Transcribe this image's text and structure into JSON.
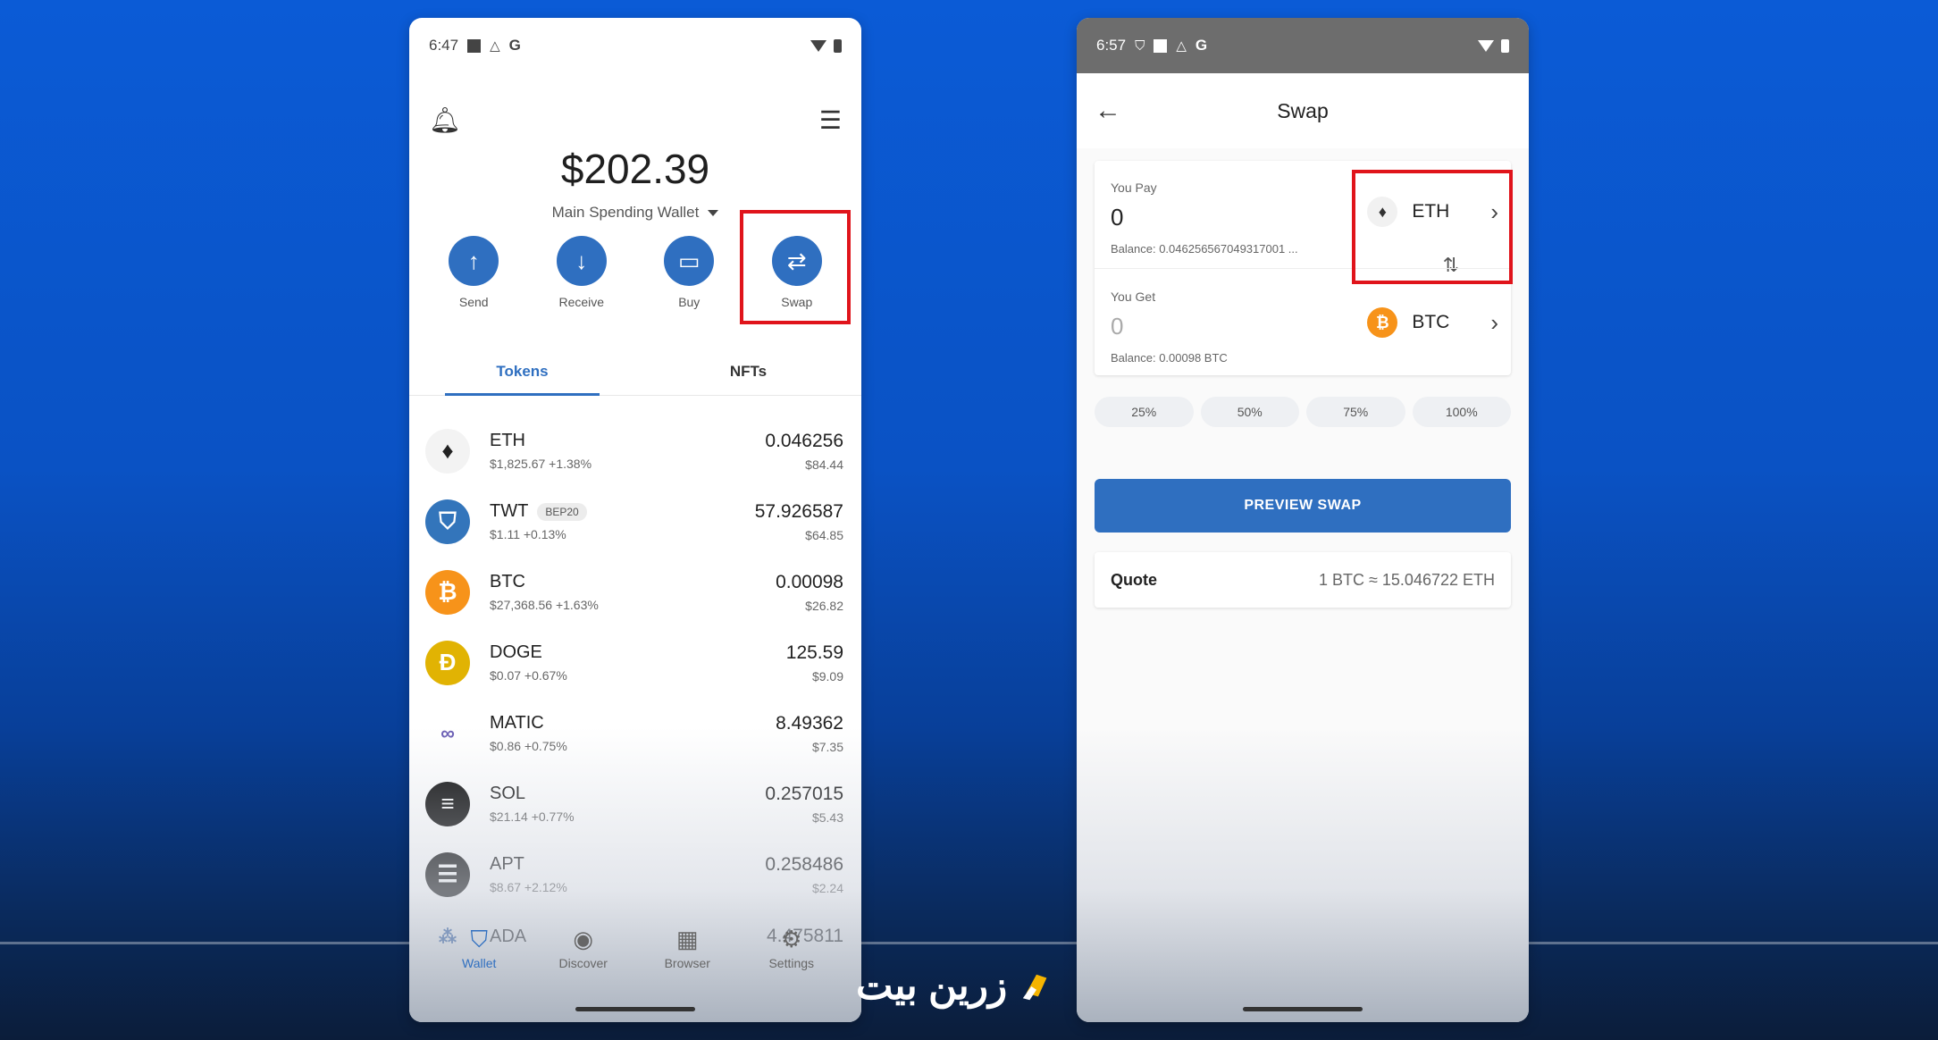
{
  "left_phone": {
    "status": {
      "time": "6:47"
    },
    "balance": "$202.39",
    "wallet_name": "Main Spending Wallet",
    "actions": [
      {
        "label": "Send",
        "icon": "arrow-up-icon"
      },
      {
        "label": "Receive",
        "icon": "arrow-down-icon"
      },
      {
        "label": "Buy",
        "icon": "card-icon"
      },
      {
        "label": "Swap",
        "icon": "swap-icon"
      }
    ],
    "tabs": [
      {
        "label": "Tokens",
        "active": true
      },
      {
        "label": "NFTs",
        "active": false
      }
    ],
    "tokens": [
      {
        "symbol": "ETH",
        "price": "$1,825.67 +1.38%",
        "qty": "0.046256",
        "usd": "$84.44",
        "color": "#ffffff"
      },
      {
        "symbol": "TWT",
        "chip": "BEP20",
        "price": "$1.11 +0.13%",
        "qty": "57.926587",
        "usd": "$64.85",
        "color": "#3375bb"
      },
      {
        "symbol": "BTC",
        "price": "$27,368.56 +1.63%",
        "qty": "0.00098",
        "usd": "$26.82",
        "color": "#f7931a"
      },
      {
        "symbol": "DOGE",
        "price": "$0.07 +0.67%",
        "qty": "125.59",
        "usd": "$9.09",
        "color": "#e1b303"
      },
      {
        "symbol": "MATIC",
        "price": "$0.86 +0.75%",
        "qty": "8.49362",
        "usd": "$7.35",
        "color": "#ffffff"
      },
      {
        "symbol": "SOL",
        "price": "$21.14 +0.77%",
        "qty": "0.257015",
        "usd": "$5.43",
        "color": "#111111"
      },
      {
        "symbol": "APT",
        "price": "$8.67 +2.12%",
        "qty": "0.258486",
        "usd": "$2.24",
        "color": "#111111"
      },
      {
        "symbol": "ADA",
        "price": "",
        "qty": "4.475811",
        "usd": "",
        "color": "#ffffff"
      }
    ],
    "nav": [
      {
        "label": "Wallet",
        "icon": "shield-icon"
      },
      {
        "label": "Discover",
        "icon": "compass-icon"
      },
      {
        "label": "Browser",
        "icon": "grid-icon"
      },
      {
        "label": "Settings",
        "icon": "gear-icon"
      }
    ]
  },
  "right_phone": {
    "status": {
      "time": "6:57"
    },
    "title": "Swap",
    "pay": {
      "label": "You Pay",
      "value": "0",
      "balance": "Balance: 0.046256567049317001 ...",
      "asset": "ETH"
    },
    "get": {
      "label": "You Get",
      "value": "0",
      "balance": "Balance: 0.00098 BTC",
      "asset": "BTC"
    },
    "percent_options": [
      "25%",
      "50%",
      "75%",
      "100%"
    ],
    "preview_button": "PREVIEW SWAP",
    "quote": {
      "label": "Quote",
      "value": "1 BTC ≈ 15.046722 ETH"
    }
  },
  "brand": {
    "text": "زرین بیت",
    "accent": "#f5b400"
  },
  "colors": {
    "accent": "#2f6fc0",
    "highlight": "#e0141b"
  }
}
